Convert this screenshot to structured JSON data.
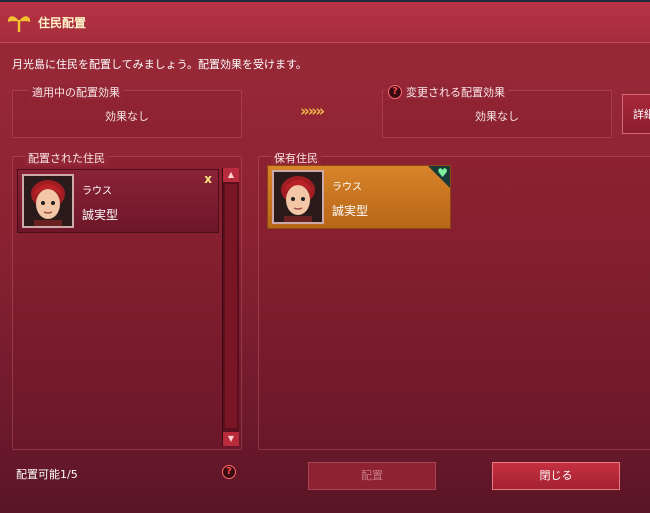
{
  "window": {
    "title": "住民配置"
  },
  "description": "月光島に住民を配置してみましょう。配置効果を受けます。",
  "effects": {
    "current_label": "適用中の配置効果",
    "current_value": "効果なし",
    "arrows": "»»»",
    "changed_label": "変更される配置効果",
    "changed_value": "効果なし",
    "detail_button": "詳細"
  },
  "placed_panel": {
    "label": "配置された住民",
    "residents": [
      {
        "name": "ラウス",
        "type": "誠実型",
        "remove": "x"
      }
    ],
    "capacity": "配置可能1/5"
  },
  "owned_panel": {
    "label": "保有住民",
    "residents": [
      {
        "name": "ラウス",
        "type": "誠実型"
      }
    ]
  },
  "buttons": {
    "place": "配置",
    "close": "閉じる"
  },
  "icons": {
    "help": "?",
    "heart": "♥"
  },
  "colors": {
    "title_text": "#fff2c8",
    "accent_orange": "#d8842a",
    "favorite_heart": "#7ef0a0"
  }
}
